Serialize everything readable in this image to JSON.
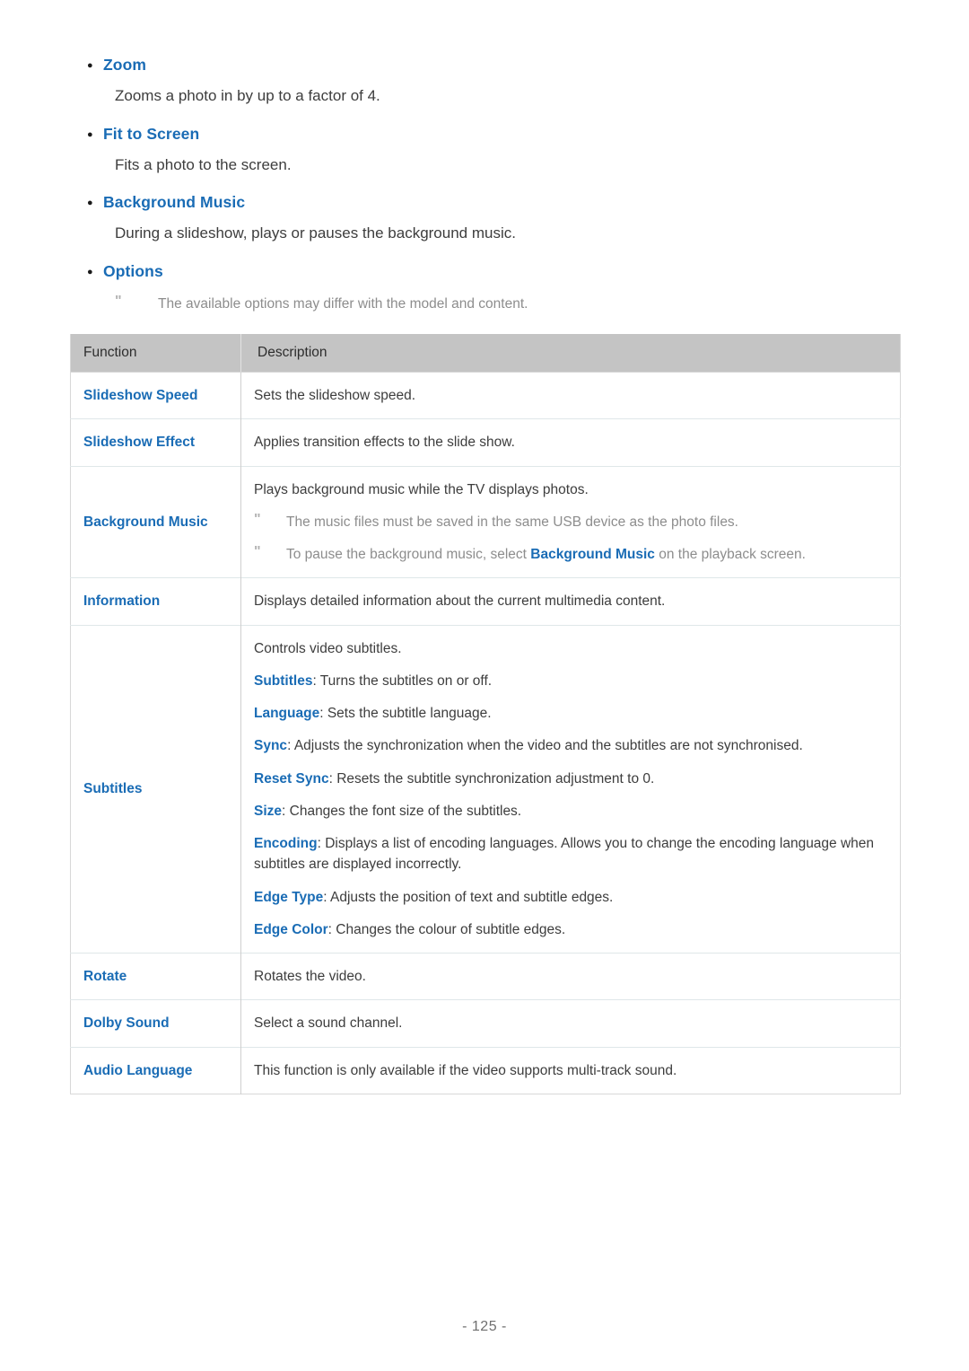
{
  "bullets": [
    {
      "title": "Zoom",
      "description": "Zooms a photo in by up to a factor of 4."
    },
    {
      "title": "Fit to Screen",
      "description": "Fits a photo to the screen."
    },
    {
      "title": "Background Music",
      "description": "During a slideshow, plays or pauses the background music."
    },
    {
      "title": "Options",
      "description": ""
    }
  ],
  "options_note": {
    "mark": "\"",
    "text": "The available options may differ with the model and content."
  },
  "table": {
    "headers": {
      "function": "Function",
      "description": "Description"
    },
    "rows": [
      {
        "function": "Slideshow Speed",
        "lines": [
          {
            "text": "Sets the slideshow speed."
          }
        ]
      },
      {
        "function": "Slideshow Effect",
        "lines": [
          {
            "text": "Applies transition effects to the slide show."
          }
        ]
      },
      {
        "function": "Background Music",
        "lines": [
          {
            "text": "Plays background music while the TV displays photos."
          },
          {
            "note": true,
            "mark": "\"",
            "text": "The music files must be saved in the same USB device as the photo files."
          },
          {
            "note": true,
            "mark": "\"",
            "pre": "To pause the background music, select ",
            "kw": "Background Music",
            "post": " on the playback screen."
          }
        ]
      },
      {
        "function": "Information",
        "lines": [
          {
            "text": "Displays detailed information about the current multimedia content."
          }
        ]
      },
      {
        "function": "Subtitles",
        "lines": [
          {
            "text": "Controls video subtitles."
          },
          {
            "kw": "Subtitles",
            "post": ": Turns the subtitles on or off."
          },
          {
            "kw": "Language",
            "post": ": Sets the subtitle language."
          },
          {
            "kw": "Sync",
            "post": ": Adjusts the synchronization when the video and the subtitles are not synchronised."
          },
          {
            "kw": "Reset Sync",
            "post": ": Resets the subtitle synchronization adjustment to 0."
          },
          {
            "kw": "Size",
            "post": ": Changes the font size of the subtitles."
          },
          {
            "kw": "Encoding",
            "post": ": Displays a list of encoding languages. Allows you to change the encoding language when subtitles are displayed incorrectly."
          },
          {
            "kw": "Edge Type",
            "post": ": Adjusts the position of text and subtitle edges."
          },
          {
            "kw": "Edge Color",
            "post": ": Changes the colour of subtitle edges."
          }
        ]
      },
      {
        "function": "Rotate",
        "lines": [
          {
            "text": "Rotates the video."
          }
        ]
      },
      {
        "function": "Dolby Sound",
        "lines": [
          {
            "text": "Select a sound channel."
          }
        ]
      },
      {
        "function": "Audio Language",
        "lines": [
          {
            "text": "This function is only available if the video supports multi-track sound."
          }
        ]
      }
    ]
  },
  "footer": {
    "page_number": "- 125 -"
  },
  "colors": {
    "link_blue": "#1a6cb5",
    "body_text": "#3d3d3d",
    "note_gray": "#8d8d8d",
    "header_bg": "#c4c4c4",
    "row_border": "#dfe7e9"
  }
}
